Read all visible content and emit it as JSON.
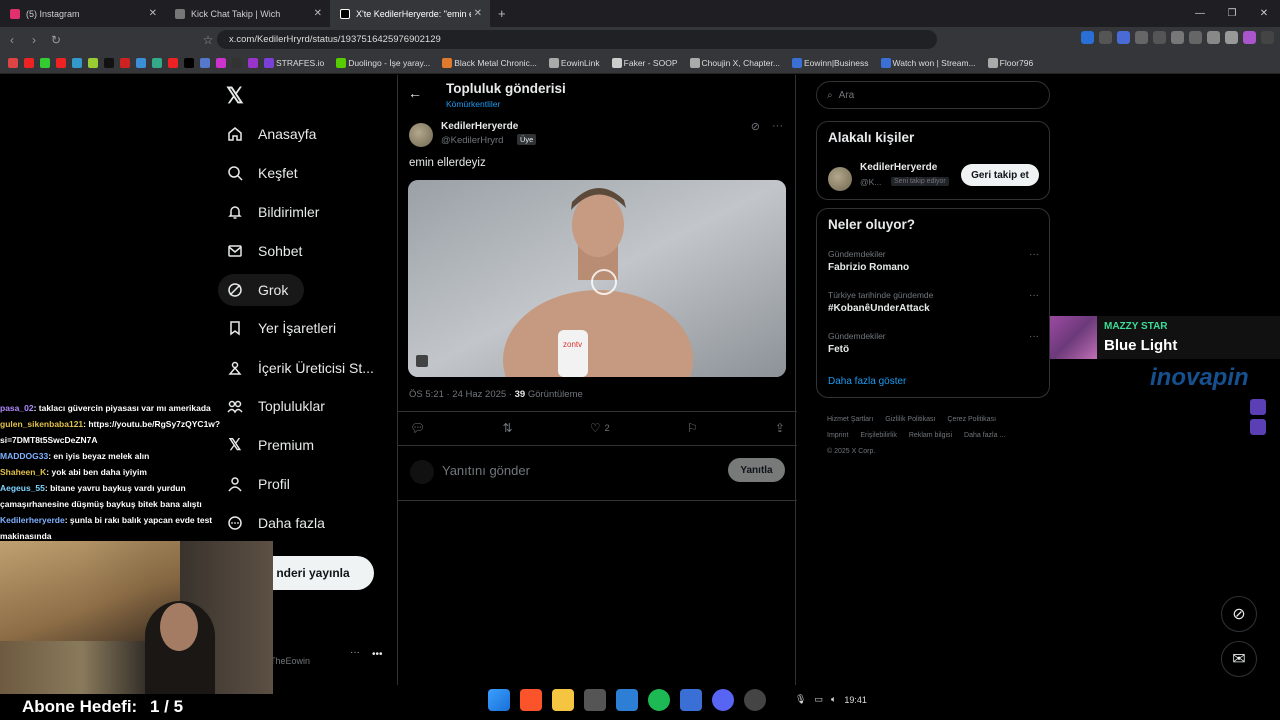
{
  "browser": {
    "tabs": [
      {
        "label": "(5) Instagram",
        "color": "#e1306c"
      },
      {
        "label": "Kick Chat Takip | Wich",
        "color": "#888888"
      },
      {
        "label": "X'te KedilerHeryerde: \"emin eller",
        "color": "#ffffff"
      }
    ],
    "url": "x.com/KedilerHryrd/status/1937516425976902129",
    "bookmarks": [
      "STRAFES.io",
      "Duolingo - İşe yaray...",
      "Black Metal Chronic...",
      "EowinLink",
      "Faker - SOOP",
      "Choujin X, Chapter...",
      "Eowinn|Business",
      "Watch won | Stream...",
      "Floor796"
    ]
  },
  "nav": {
    "items": [
      {
        "label": "Anasayfa",
        "icon": "home-icon"
      },
      {
        "label": "Keşfet",
        "icon": "search-icon"
      },
      {
        "label": "Bildirimler",
        "icon": "bell-icon"
      },
      {
        "label": "Sohbet",
        "icon": "mail-icon"
      },
      {
        "label": "Grok",
        "icon": "grok-icon"
      },
      {
        "label": "Yer İşaretleri",
        "icon": "bookmark-icon"
      },
      {
        "label": "İçerik Üreticisi St...",
        "icon": "creator-icon"
      },
      {
        "label": "Topluluklar",
        "icon": "communities-icon"
      },
      {
        "label": "Premium",
        "icon": "x-icon"
      },
      {
        "label": "Profil",
        "icon": "person-icon"
      },
      {
        "label": "Daha fazla",
        "icon": "more-icon"
      }
    ],
    "post_button": "nderi yayınla",
    "account_name": "TheEowin"
  },
  "header": {
    "title": "Topluluk gönderisi",
    "subtitle": "Kömürkentliler"
  },
  "post": {
    "name": "KedilerHeryerde",
    "handle": "@KedilerHryrd",
    "badge": "Üye",
    "text": "emin ellerdeyiz",
    "time": "ÖS 5:21 · 24 Haz 2025 ·",
    "views": "39",
    "views_label": "Görüntüleme",
    "likes": "2",
    "media_label": "zontv"
  },
  "reply": {
    "placeholder": "Yanıtını gönder",
    "button": "Yanıtla"
  },
  "search": {
    "placeholder": "Ara"
  },
  "related": {
    "title": "Alakalı kişiler",
    "name": "KedilerHeryerde",
    "handle": "@K...",
    "follows_you": "Seni takip ediyor",
    "button": "Geri takip et"
  },
  "trends": {
    "title": "Neler oluyor?",
    "items": [
      {
        "context": "Gündemdekiler",
        "name": "Fabrizio Romano"
      },
      {
        "context": "Türkiye tarihinde gündemde",
        "name": "#KobanêUnderAttack"
      },
      {
        "context": "Gündemdekiler",
        "name": "Fetö"
      }
    ],
    "show_more": "Daha fazla göster"
  },
  "footer": {
    "links": [
      "Hizmet Şartları",
      "Gizlilik Politikası",
      "Çerez Politikası",
      "Imprint",
      "Erişilebilirlik",
      "Reklam bilgisi",
      "Daha fazla ..."
    ],
    "copyright": "© 2025 X Corp."
  },
  "overlay": {
    "now_playing_artist": "MAZZY STAR",
    "now_playing_song": "Blue Light",
    "sponsor": "inovapin",
    "chat": [
      {
        "user": "pasa_02",
        "color": "#b18cff",
        "msg": ": taklacı güvercin piyasası var mı amerikada"
      },
      {
        "user": "gulen_sikenbaba121",
        "color": "#e0c14a",
        "msg": ": https://youtu.be/RgSy7zQYC1w?si=7DMT8t5SwcDeZN7A"
      },
      {
        "user": "MADDOG33",
        "color": "#7fb2ff",
        "msg": ": en iyis beyaz melek alın"
      },
      {
        "user": "Shaheen_K",
        "color": "#e0c14a",
        "msg": ": yok abi ben daha iyiyim"
      },
      {
        "user": "Aegeus_55",
        "color": "#7fd4ff",
        "msg": ": bitane yavru baykuş vardı yurdun çamaşırhanesine düşmüş baykuş bitek bana alıştı"
      },
      {
        "user": "Kedilerheryerde",
        "color": "#7fb2ff",
        "msg": ": şunla bi rakı balık yapcan evde test makinasında"
      }
    ],
    "goal_label": "Abone Hedefi:",
    "goal_value": "1 / 5"
  },
  "taskbar": {
    "clock": "19:41"
  }
}
